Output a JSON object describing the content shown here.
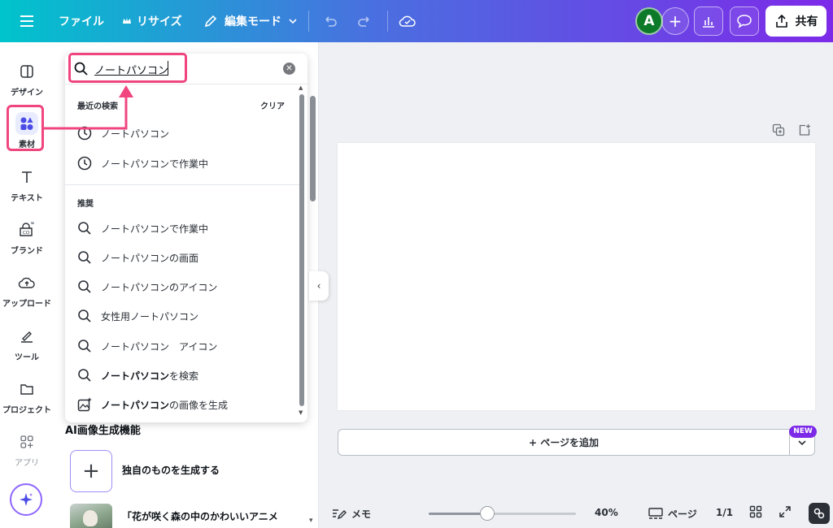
{
  "header": {
    "file_label": "ファイル",
    "resize_label": "リサイズ",
    "edit_mode_label": "編集モード",
    "avatar_initial": "A",
    "share_label": "共有"
  },
  "rail": {
    "items": [
      {
        "label": "デザイン",
        "icon": "design-icon"
      },
      {
        "label": "素材",
        "icon": "elements-icon"
      },
      {
        "label": "テキスト",
        "icon": "text-icon"
      },
      {
        "label": "ブランド",
        "icon": "brand-icon"
      },
      {
        "label": "アップロード",
        "icon": "upload-icon"
      },
      {
        "label": "ツール",
        "icon": "tools-icon"
      },
      {
        "label": "プロジェクト",
        "icon": "folder-icon"
      },
      {
        "label": "アプリ",
        "icon": "apps-icon"
      }
    ]
  },
  "search": {
    "value": "ノートパソコン",
    "recent_heading": "最近の検索",
    "clear_label": "クリア",
    "recent": [
      "ノートパソコン",
      "ノートパソコンで作業中"
    ],
    "suggest_heading": "推奨",
    "suggestions": [
      "ノートパソコンで作業中",
      "ノートパソコンの画面",
      "ノートパソコンのアイコン",
      "女性用ノートパソコン",
      "ノートパソコン　アイコン"
    ],
    "search_action_bold": "ノートパソコン",
    "search_action_rest": "を検索",
    "generate_action_bold": "ノートパソコン",
    "generate_action_rest": "の画像を生成"
  },
  "panel": {
    "ai_heading": "AI画像生成機能",
    "generate_own_label": "独自のものを生成する",
    "prompt_example": "「花が咲く森の中のかわいいアニメ"
  },
  "canvas": {
    "add_page_label": "+ ページを追加",
    "new_badge": "NEW"
  },
  "bottom": {
    "notes_label": "メモ",
    "zoom_value": 40,
    "zoom_label": "40%",
    "pages_label": "ページ",
    "page_count": "1/1"
  },
  "colors": {
    "accent_pink": "#f0457e",
    "brand_purple": "#7d2ae8",
    "header_start": "#00c4cc",
    "header_end": "#7d2ae8"
  }
}
